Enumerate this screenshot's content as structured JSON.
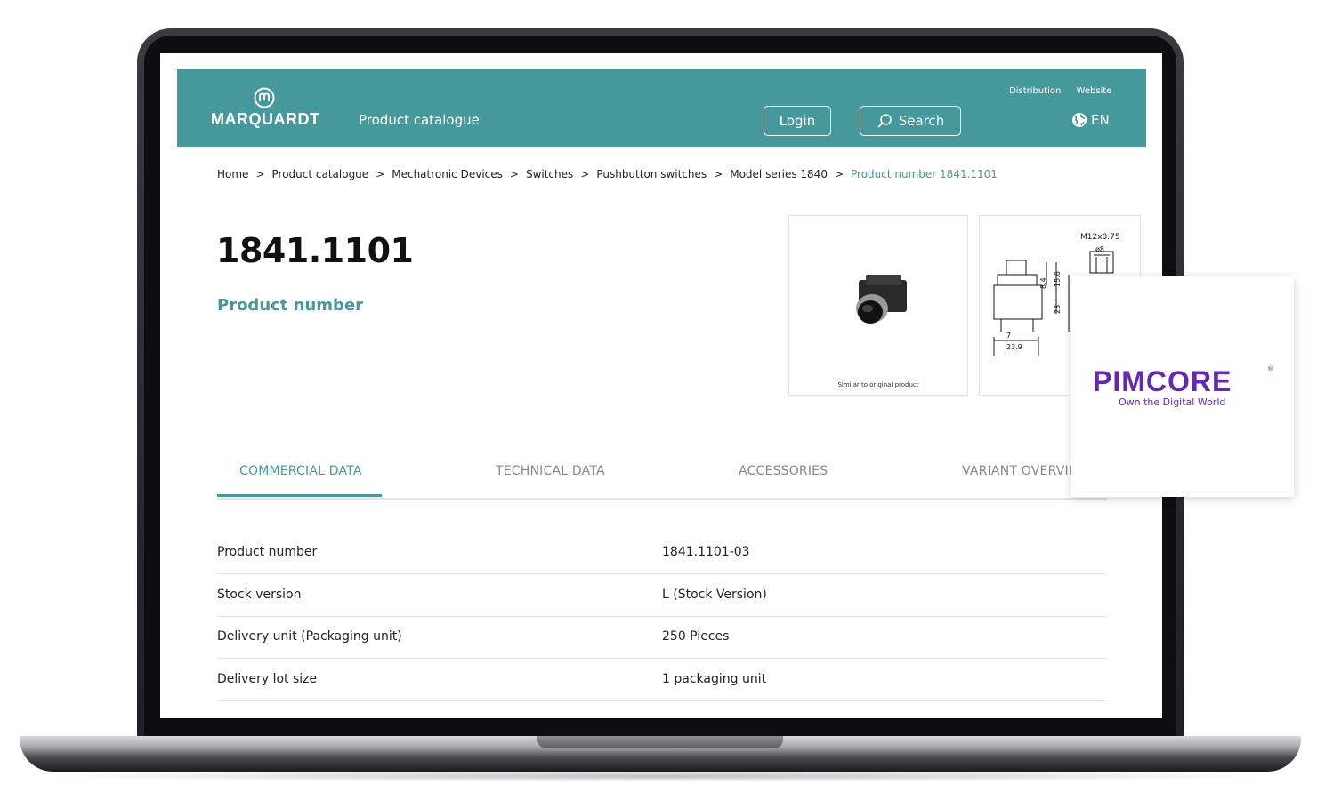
{
  "header": {
    "logo_text": "MARQUARDT",
    "title": "Product catalogue",
    "login_label": "Login",
    "search_label": "Search",
    "links": [
      "Distribution",
      "Website"
    ],
    "language": "EN",
    "color": "#45999b"
  },
  "breadcrumb": [
    "Home",
    "Product catalogue",
    "Mechatronic Devices",
    "Switches",
    "Pushbutton switches",
    "Model series 1840",
    "Product number 1841.1101"
  ],
  "breadcrumb_separator": ">",
  "product": {
    "number": "1841.1101",
    "label": "Product number",
    "image_caption": "Similar to original product",
    "drawing_labels": [
      "M12x0.75",
      "ø8",
      "8.4",
      "15.6",
      "23",
      "7",
      "23.9"
    ]
  },
  "tabs": [
    "COMMERCIAL DATA",
    "TECHNICAL DATA",
    "ACCESSORIES",
    "VARIANT OVERVIE"
  ],
  "active_tab": 0,
  "commercial_data": [
    {
      "key": "Product number",
      "value": "1841.1101-03"
    },
    {
      "key": "Stock version",
      "value": "L (Stock Version)"
    },
    {
      "key": "Delivery unit (Packaging unit)",
      "value": "250 Pieces"
    },
    {
      "key": "Delivery lot size",
      "value": "1 packaging unit"
    }
  ],
  "pimcore": {
    "logo": "PIMCORE",
    "tagline": "Own the Digital World",
    "reg": "®",
    "color": "#6428b4"
  }
}
